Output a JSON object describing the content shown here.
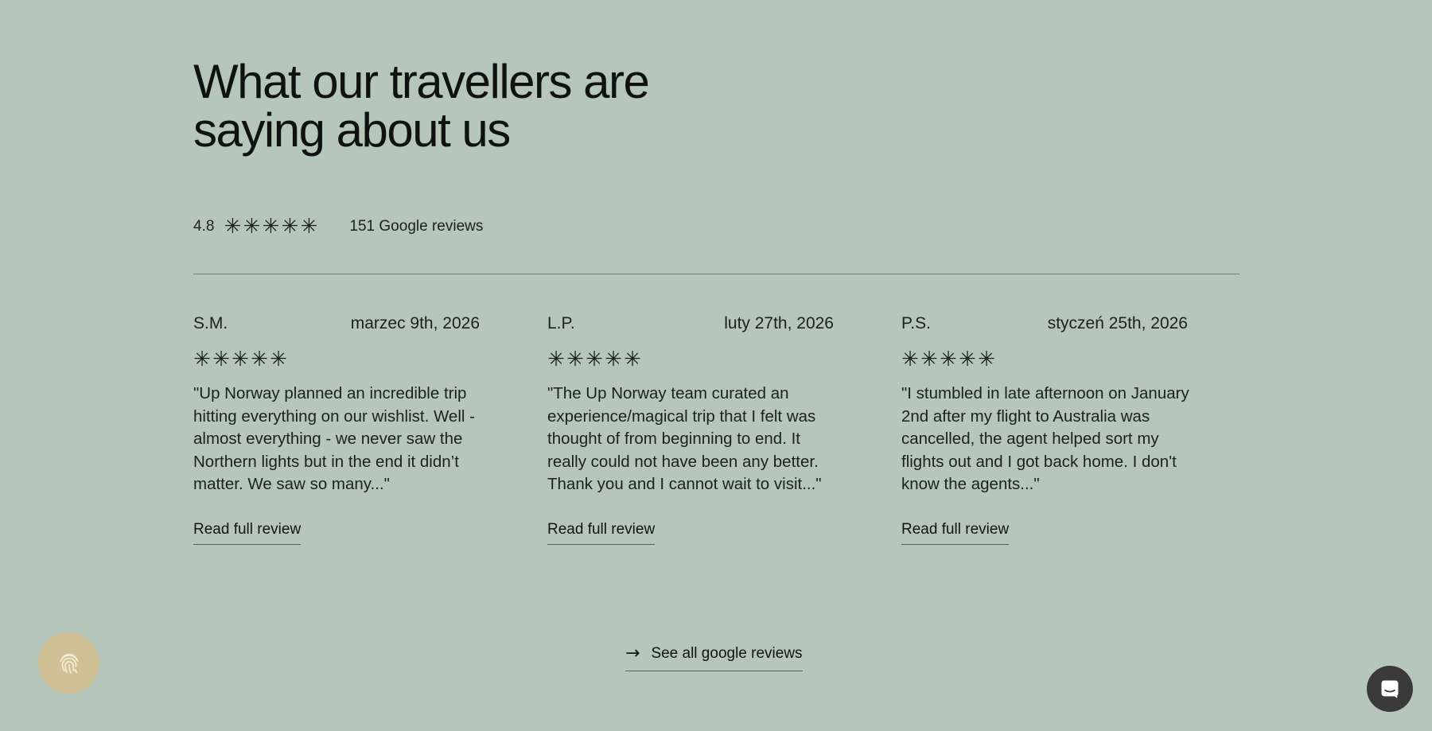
{
  "heading": {
    "line1": "What our travellers are",
    "line2": "saying about us"
  },
  "rating": {
    "value": "4.8",
    "stars": 5,
    "count_label": "151 Google reviews"
  },
  "reviews": [
    {
      "author": "S.M.",
      "date": "marzec 9th, 2026",
      "stars": 5,
      "text": "\"Up Norway planned an incredible trip hitting everything on our wishlist. Well - almost everything - we never saw the Northern lights but in the end it didn’t matter. We saw so many...\"",
      "link_label": "Read full review"
    },
    {
      "author": "L.P.",
      "date": "luty 27th, 2026",
      "stars": 5,
      "text": "\"The Up Norway team curated an experience/magical trip that I felt was thought of from beginning to end. It really could not have been any better. Thank you and I cannot wait to visit...\"",
      "link_label": "Read full review"
    },
    {
      "author": "P.S.",
      "date": "styczeń 25th, 2026",
      "stars": 5,
      "text": "\"I stumbled in late afternoon on January 2nd after my flight to Australia was cancelled, the agent helped sort my flights out and I got back home. I don't know the agents...\"",
      "link_label": "Read full review"
    }
  ],
  "see_all_label": "See all google reviews",
  "icons": {
    "star": "asterisk-star-icon",
    "arrow": "arrow-right-icon",
    "fingerprint": "fingerprint-icon",
    "chat": "chat-icon"
  },
  "colors": {
    "background": "#b6c6bb",
    "fingerprint_button": "#cfc095",
    "chat_button": "#3a3a3a"
  }
}
